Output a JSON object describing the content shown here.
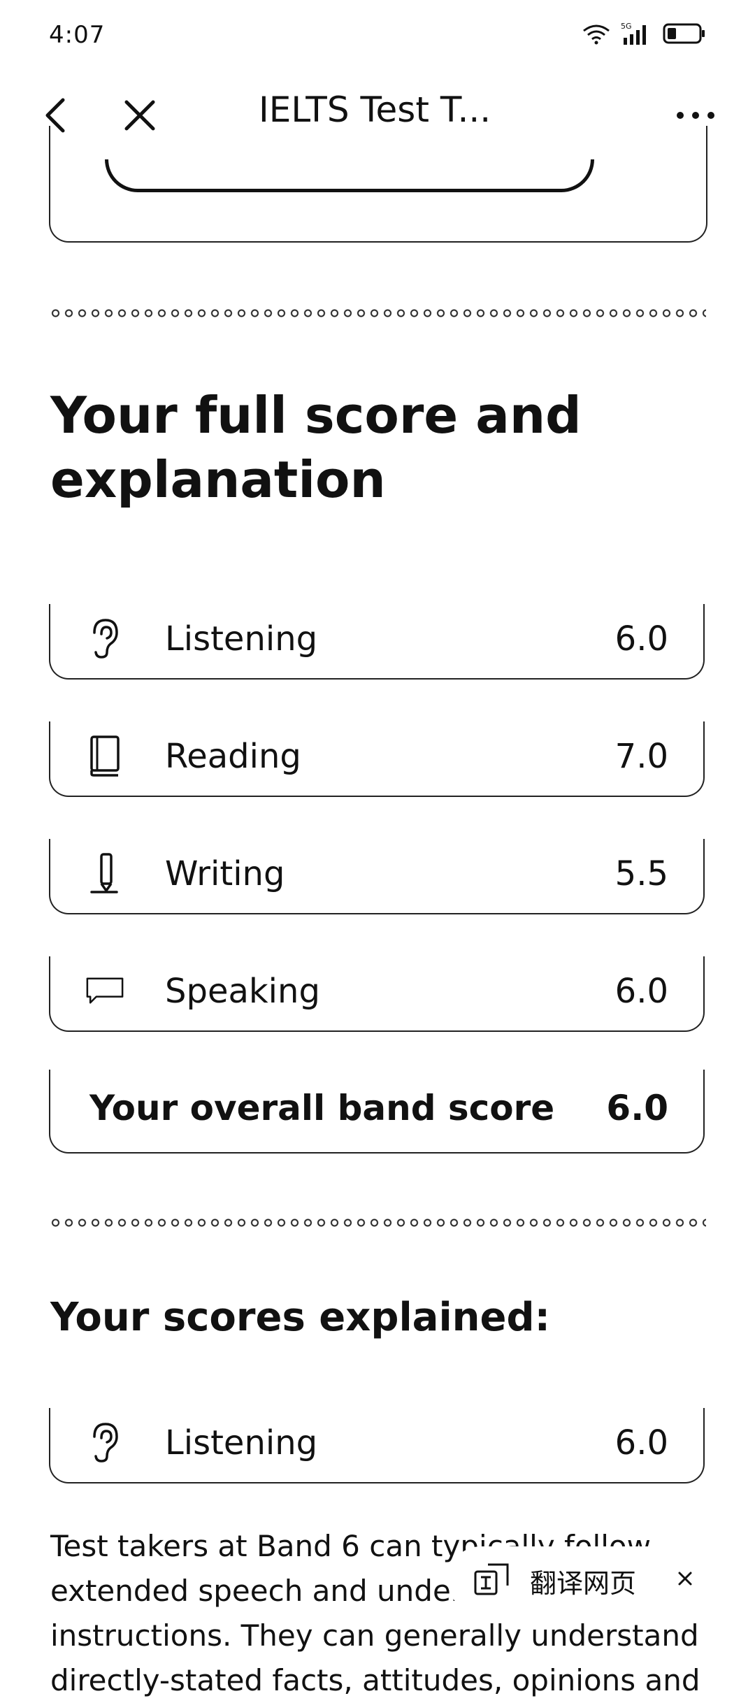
{
  "status_bar": {
    "time": "4:07",
    "icons": [
      "wifi-icon",
      "signal-5g-icon",
      "battery-icon"
    ]
  },
  "nav": {
    "title": "IELTS Test T...",
    "back_icon": "chevron-left-icon",
    "close_icon": "close-icon",
    "more_icon": "more-icon"
  },
  "section_title": "Your full score and explanation",
  "scores": [
    {
      "label": "Listening",
      "value": "6.0",
      "icon": "ear-icon"
    },
    {
      "label": "Reading",
      "value": "7.0",
      "icon": "book-icon"
    },
    {
      "label": "Writing",
      "value": "5.5",
      "icon": "pencil-icon"
    },
    {
      "label": "Speaking",
      "value": "6.0",
      "icon": "speech-bubble-icon"
    }
  ],
  "overall": {
    "label": "Your overall band score",
    "value": "6.0"
  },
  "explained": {
    "title": "Your scores explained:",
    "item": {
      "label": "Listening",
      "value": "6.0",
      "icon": "ear-icon"
    },
    "body_lines": [
      "Test takers at Band 6 can typically follow",
      "extended speech and understand",
      "instructions. They can generally understand",
      "directly-stated facts, attitudes, opinions and"
    ]
  },
  "translate_popup": {
    "label": "翻译网页",
    "icon": "translate-icon",
    "close_icon": "close-icon"
  }
}
